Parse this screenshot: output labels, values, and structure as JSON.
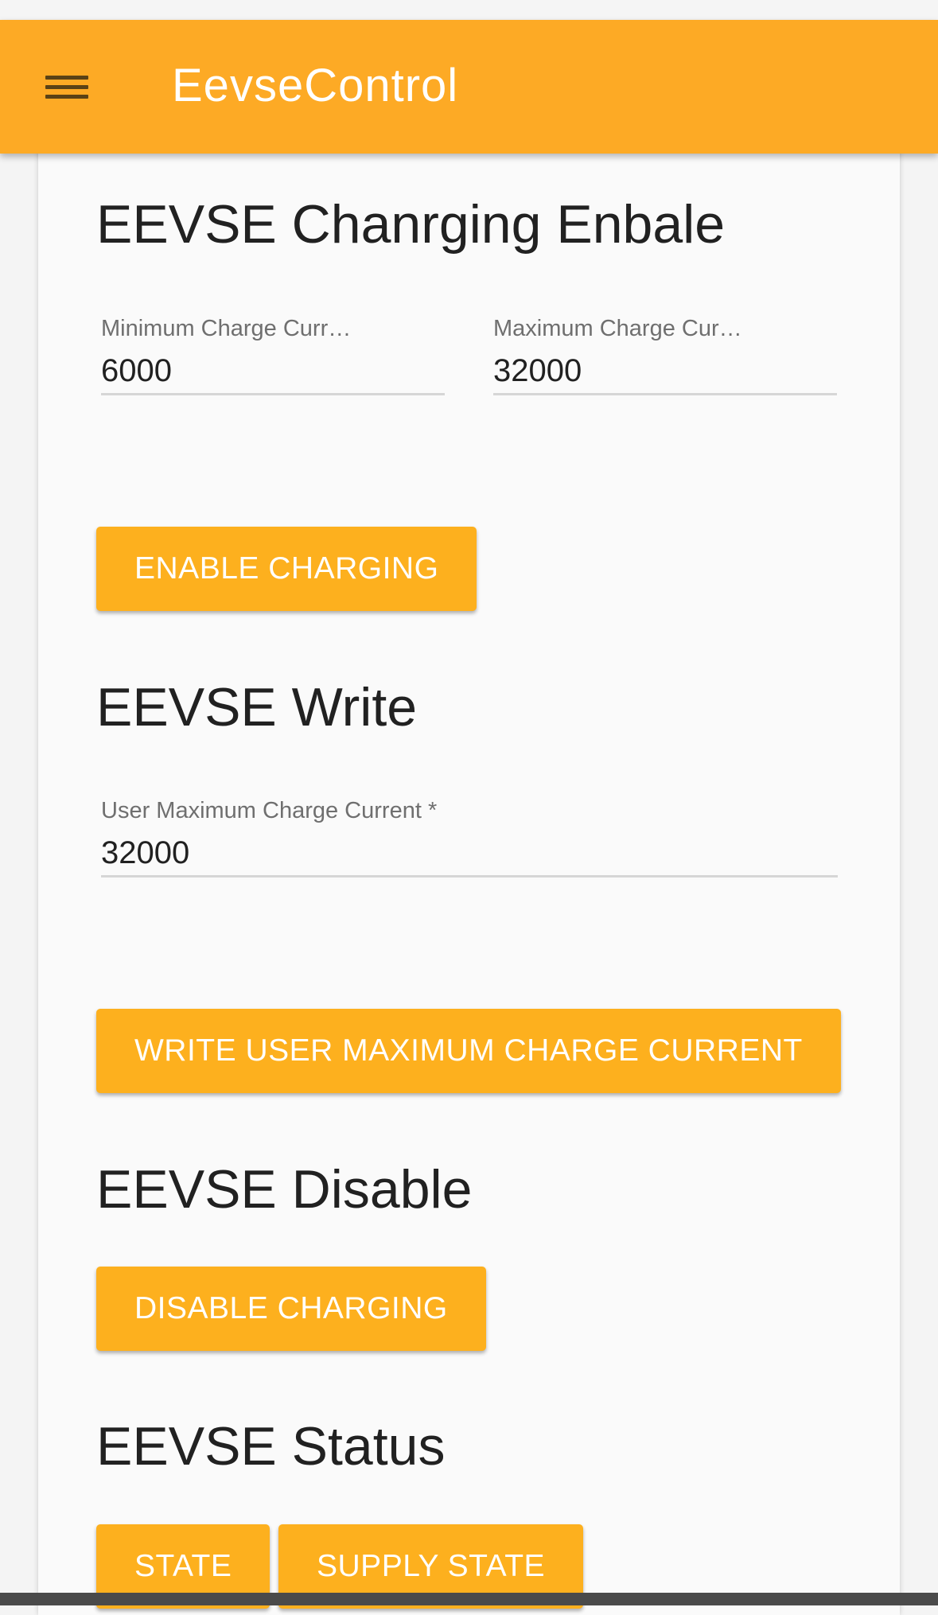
{
  "app_bar": {
    "title": "EevseControl",
    "menu_icon": "hamburger-menu-icon",
    "background_color": "#fdaa25"
  },
  "sections": {
    "enable": {
      "title": "EEVSE Chanrging Enbale",
      "min_field": {
        "label": "Minimum Charge Curr…",
        "value": "6000"
      },
      "max_field": {
        "label": "Maximum Charge Cur…",
        "value": "32000"
      },
      "button_label": "ENABLE CHARGING"
    },
    "write": {
      "title": "EEVSE Write",
      "user_max_field": {
        "label": "User Maximum Charge Current *",
        "value": "32000"
      },
      "button_label": "WRITE USER MAXIMUM CHARGE CURRENT"
    },
    "disable": {
      "title": "EEVSE Disable",
      "button_label": "DISABLE CHARGING"
    },
    "status": {
      "title": "EEVSE Status",
      "state_button_label": "STATE",
      "supply_state_button_label": "SUPPLY STATE"
    }
  },
  "colors": {
    "button": "#fdb01e",
    "button_text": "#ffffff",
    "heading_text": "#212121"
  }
}
